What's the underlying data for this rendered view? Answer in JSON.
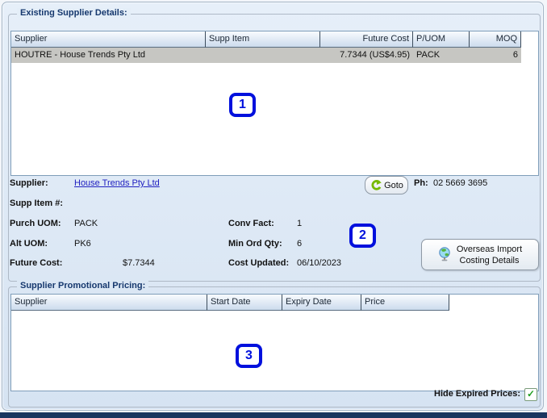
{
  "existing": {
    "title": "Existing Supplier Details:",
    "headers": [
      "Supplier",
      "Supp Item",
      "Future Cost",
      "P/UOM",
      "MOQ"
    ],
    "row": {
      "supplier": "HOUTRE - House Trends Pty Ltd",
      "supp_item": "",
      "future_cost": "7.7344 (US$4.95)",
      "puom": "PACK",
      "moq": "6"
    }
  },
  "badges": {
    "one": "1",
    "two": "2",
    "three": "3"
  },
  "details": {
    "supplier_label": "Supplier:",
    "supplier_link": "House Trends Pty Ltd",
    "goto_label": "Goto",
    "ph_label": "Ph:",
    "phone": "02 5669 3695",
    "supp_item_label": "Supp Item #:",
    "purch_uom_label": "Purch UOM:",
    "purch_uom": "PACK",
    "conv_fact_label": "Conv Fact:",
    "conv_fact": "1",
    "alt_uom_label": "Alt UOM:",
    "alt_uom": "PK6",
    "min_ord_label": "Min Ord Qty:",
    "min_ord_qty": "6",
    "future_cost_label": "Future Cost:",
    "future_cost": "$7.7344",
    "cost_updated_label": "Cost Updated:",
    "cost_updated": "06/10/2023",
    "overseas_line1": "Overseas Import",
    "overseas_line2": "Costing Details"
  },
  "promo": {
    "title": "Supplier Promotional Pricing:",
    "headers": [
      "Supplier",
      "Start Date",
      "Expiry Date",
      "Price"
    ],
    "hide_expired_label": "Hide Expired Prices:",
    "hide_expired_checked": true
  },
  "icons": {
    "goto": "circular-arrow",
    "overseas": "desk-globe",
    "check_glyph": "✓"
  },
  "colors": {
    "accent_badge": "#0010dd",
    "link": "#2020c0",
    "goto_green": "#76b900",
    "check_green": "#1f9e1f",
    "selected_row": "#c6c6c2",
    "navy_bar": "#1a355f"
  }
}
